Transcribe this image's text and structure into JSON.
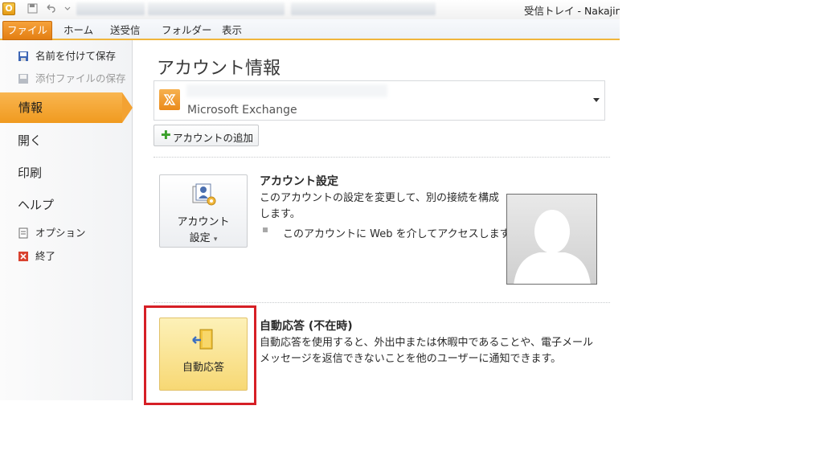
{
  "window": {
    "title": "受信トレイ - Nakajin"
  },
  "ribbon": {
    "tabs": [
      "ファイル",
      "ホーム",
      "送受信",
      "フォルダー",
      "表示"
    ]
  },
  "left_nav": {
    "save_as": "名前を付けて保存",
    "save_attachments": "添付ファイルの保存",
    "info": "情報",
    "open": "開く",
    "print": "印刷",
    "help": "ヘルプ",
    "options": "オプション",
    "exit": "終了"
  },
  "main": {
    "page_title": "アカウント情報",
    "account_type": "Microsoft Exchange",
    "add_account": "アカウントの追加",
    "account_settings": {
      "button_line1": "アカウント",
      "button_line2": "設定",
      "title": "アカウント設定",
      "description_line1": "このアカウントの設定を変更して、別の接続を構成",
      "description_line2": "します。",
      "web_access": "このアカウントに Web を介してアクセスします。"
    },
    "auto_reply": {
      "button_label": "自動応答",
      "title": "自動応答 (不在時)",
      "description_line1": "自動応答を使用すると、外出中または休暇中であることや、電子メール",
      "description_line2": "メッセージを返信できないことを他のユーザーに通知できます。"
    }
  },
  "colors": {
    "file_tab": "#e98a1c",
    "selected_nav": "#f3a232",
    "highlight": "#d61f26",
    "auto_reply_button": "#f7d874"
  }
}
